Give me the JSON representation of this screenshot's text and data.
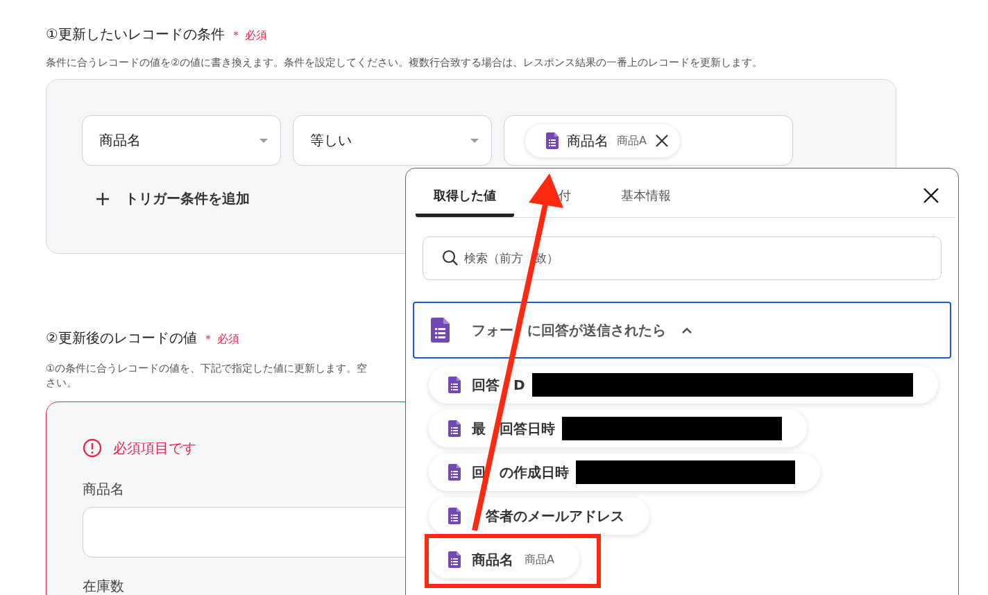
{
  "section1": {
    "title": "①更新したいレコードの条件",
    "required": "＊ 必須",
    "description": "条件に合うレコードの値を②の値に書き換えます。条件を設定してください。複数行合致する場合は、レスポンス結果の一番上のレコードを更新します。"
  },
  "condition": {
    "field": "商品名",
    "operator": "等しい",
    "value_chip": {
      "name": "商品名",
      "value": "商品A"
    }
  },
  "add_condition": {
    "label": "トリガー条件を追加"
  },
  "section2": {
    "title": "②更新後のレコードの値",
    "required": "＊ 必須",
    "description_lines": [
      "①の条件に合うレコードの値を、下記で指定した値に更新します。空",
      "さい。"
    ],
    "error": "必須項目です",
    "fields": [
      {
        "label": "商品名",
        "kind": "input"
      },
      {
        "label": "在庫数",
        "kind": "label"
      }
    ]
  },
  "popup": {
    "tabs": [
      {
        "label_parts": [
          {
            "kind": "text",
            "text": "取得した値"
          }
        ],
        "selected": true
      },
      {
        "label_parts": [
          {
            "kind": "covered"
          },
          {
            "kind": "text",
            "text": "付"
          }
        ],
        "selected": false
      },
      {
        "label_parts": [
          {
            "kind": "text",
            "text": "基本情報"
          }
        ],
        "selected": false
      }
    ],
    "search": {
      "placeholder_parts": [
        {
          "kind": "text",
          "text": "検索（前方"
        },
        {
          "kind": "covered"
        },
        {
          "kind": "text",
          "text": "致）"
        }
      ]
    },
    "group": {
      "title_parts": [
        {
          "kind": "text",
          "text": "フォー"
        },
        {
          "kind": "covered"
        },
        {
          "kind": "text",
          "text": "に回答が送信されたら"
        }
      ],
      "expanded": true,
      "items": [
        {
          "label_parts": [
            {
              "kind": "text",
              "text": "回答"
            },
            {
              "kind": "covered"
            },
            {
              "kind": "text",
              "text": "D"
            }
          ],
          "redacted": true,
          "highlighted": false
        },
        {
          "label_parts": [
            {
              "kind": "text",
              "text": "最"
            },
            {
              "kind": "covered"
            },
            {
              "kind": "text",
              "text": "回答日時"
            }
          ],
          "redacted": true,
          "highlighted": false
        },
        {
          "label_parts": [
            {
              "kind": "text",
              "text": "回"
            },
            {
              "kind": "covered"
            },
            {
              "kind": "text",
              "text": "の作成日時"
            }
          ],
          "redacted": true,
          "highlighted": false
        },
        {
          "label_parts": [
            {
              "kind": "covered"
            },
            {
              "kind": "text",
              "text": "答者のメールアドレス"
            }
          ],
          "redacted": false,
          "highlighted": false
        },
        {
          "label_parts": [
            {
              "kind": "text",
              "text": "商品名"
            }
          ],
          "value": "商品A",
          "redacted": false,
          "highlighted": true
        }
      ]
    }
  }
}
